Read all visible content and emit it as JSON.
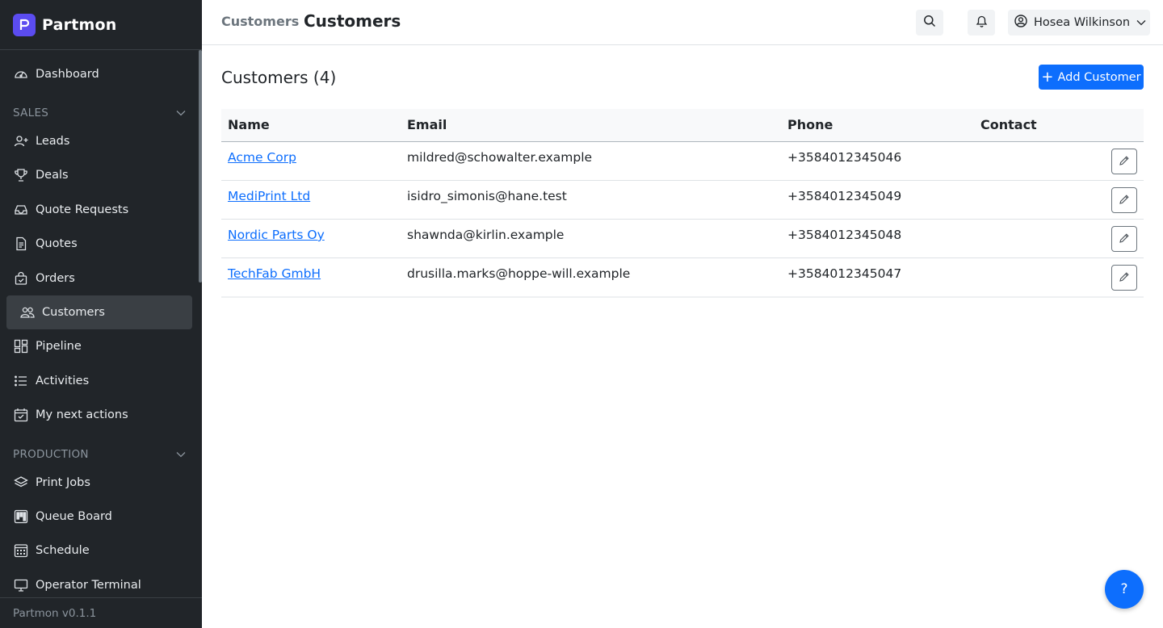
{
  "app": {
    "name": "Partmon",
    "version": "Partmon v0.1.1"
  },
  "colors": {
    "sidebar_bg": "#212529",
    "primary": "#0d6efd",
    "brand": "#5b4cf0"
  },
  "sidebar": {
    "dashboard": {
      "label": "Dashboard",
      "icon": "dashboard-gauge-icon"
    },
    "sales_section": "SALES",
    "sales_items": [
      {
        "label": "Leads",
        "icon": "person-plus-icon"
      },
      {
        "label": "Deals",
        "icon": "trophy-icon"
      },
      {
        "label": "Quote Requests",
        "icon": "inbox-icon"
      },
      {
        "label": "Quotes",
        "icon": "document-icon"
      },
      {
        "label": "Orders",
        "icon": "bag-icon"
      },
      {
        "label": "Customers",
        "icon": "people-icon",
        "active": true
      },
      {
        "label": "Pipeline",
        "icon": "kanban-icon"
      },
      {
        "label": "Activities",
        "icon": "list-icon"
      },
      {
        "label": "My next actions",
        "icon": "calendar-check-icon"
      }
    ],
    "production_section": "PRODUCTION",
    "production_items": [
      {
        "label": "Print Jobs",
        "icon": "layers-icon"
      },
      {
        "label": "Queue Board",
        "icon": "board-icon"
      },
      {
        "label": "Schedule",
        "icon": "calendar-grid-icon"
      },
      {
        "label": "Operator Terminal",
        "icon": "monitor-icon"
      }
    ]
  },
  "header": {
    "breadcrumb": "Customers",
    "title": "Customers",
    "user_name": "Hosea Wilkinson"
  },
  "main": {
    "section_title": "Customers (4)",
    "add_button": "Add Customer",
    "columns": [
      "Name",
      "Email",
      "Phone",
      "Contact"
    ],
    "rows": [
      {
        "name": "Acme Corp",
        "email": "mildred@schowalter.example",
        "phone": "+3584012345046",
        "contact": ""
      },
      {
        "name": "MediPrint Ltd",
        "email": "isidro_simonis@hane.test",
        "phone": "+3584012345049",
        "contact": ""
      },
      {
        "name": "Nordic Parts Oy",
        "email": "shawnda@kirlin.example",
        "phone": "+3584012345048",
        "contact": ""
      },
      {
        "name": "TechFab GmbH",
        "email": "drusilla.marks@hoppe-will.example",
        "phone": "+3584012345047",
        "contact": ""
      }
    ]
  },
  "help_button": "?"
}
